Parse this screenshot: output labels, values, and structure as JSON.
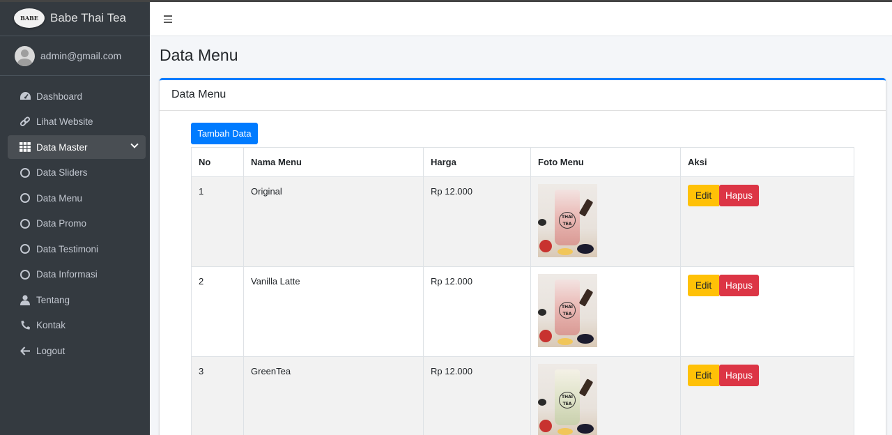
{
  "brand": {
    "name": "Babe Thai Tea",
    "logo_text": "BABE"
  },
  "user": {
    "email": "admin@gmail.com"
  },
  "sidebar": {
    "items": [
      {
        "label": "Dashboard",
        "icon": "dashboard-icon"
      },
      {
        "label": "Lihat Website",
        "icon": "link-icon"
      },
      {
        "label": "Data Master",
        "icon": "grid-icon",
        "active": true
      },
      {
        "label": "Data Sliders",
        "icon": "circle-icon"
      },
      {
        "label": "Data Menu",
        "icon": "circle-icon"
      },
      {
        "label": "Data Promo",
        "icon": "circle-icon"
      },
      {
        "label": "Data Testimoni",
        "icon": "circle-icon"
      },
      {
        "label": "Data Informasi",
        "icon": "circle-icon"
      },
      {
        "label": "Tentang",
        "icon": "user-icon"
      },
      {
        "label": "Kontak",
        "icon": "phone-icon"
      },
      {
        "label": "Logout",
        "icon": "arrow-left-icon"
      }
    ]
  },
  "page": {
    "title": "Data Menu"
  },
  "card": {
    "title": "Data Menu",
    "add_button": "Tambah Data",
    "table": {
      "headers": [
        "No",
        "Nama Menu",
        "Harga",
        "Foto Menu",
        "Aksi"
      ],
      "rows": [
        {
          "no": "1",
          "name": "Original",
          "price": "Rp 12.000",
          "photo_label": "THAI TEA"
        },
        {
          "no": "2",
          "name": "Vanilla Latte",
          "price": "Rp 12.000",
          "photo_label": "THAI TEA"
        },
        {
          "no": "3",
          "name": "GreenTea",
          "price": "Rp 12.000",
          "photo_label": "THAI TEA"
        }
      ],
      "edit_label": "Edit",
      "delete_label": "Hapus"
    }
  },
  "colors": {
    "sidebar": "#343a40",
    "primary": "#007bff",
    "warning": "#ffc107",
    "danger": "#dc3545"
  }
}
